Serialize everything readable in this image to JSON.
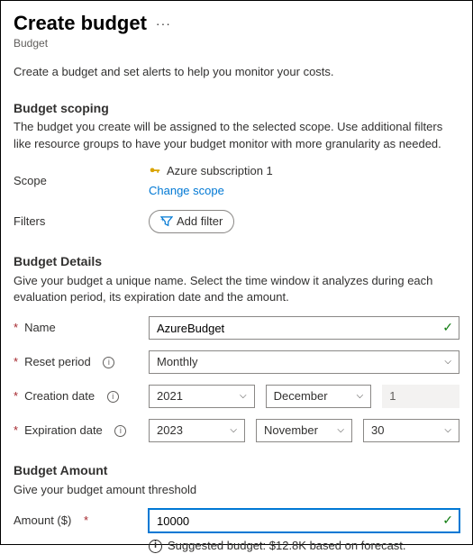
{
  "header": {
    "title": "Create budget",
    "subtitle": "Budget",
    "intro": "Create a budget and set alerts to help you monitor your costs."
  },
  "scoping": {
    "heading": "Budget scoping",
    "description": "The budget you create will be assigned to the selected scope. Use additional filters like resource groups to have your budget monitor with more granularity as needed.",
    "scope_label": "Scope",
    "scope_value": "Azure subscription 1",
    "change_scope": "Change scope",
    "filters_label": "Filters",
    "add_filter": "Add filter"
  },
  "details": {
    "heading": "Budget Details",
    "description": "Give your budget a unique name. Select the time window it analyzes during each evaluation period, its expiration date and the amount.",
    "name_label": "Name",
    "name_value": "AzureBudget",
    "reset_label": "Reset period",
    "reset_value": "Monthly",
    "creation_label": "Creation date",
    "creation_year": "2021",
    "creation_month": "December",
    "creation_day": "1",
    "expiration_label": "Expiration date",
    "expiration_year": "2023",
    "expiration_month": "November",
    "expiration_day": "30"
  },
  "amount": {
    "heading": "Budget Amount",
    "description": "Give your budget amount threshold",
    "amount_label": "Amount ($)",
    "amount_value": "10000",
    "suggestion": "Suggested budget: $12.8K based on forecast."
  }
}
